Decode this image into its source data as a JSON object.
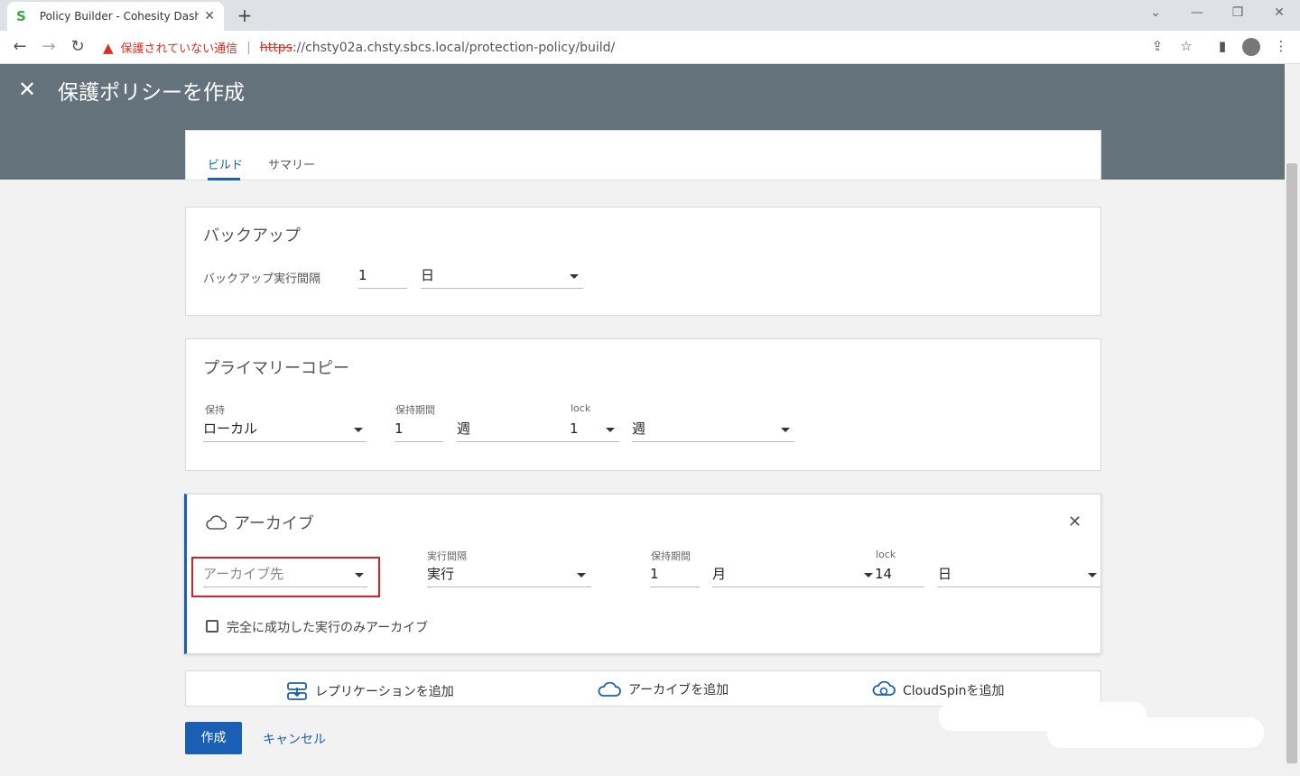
{
  "browser": {
    "tab_title": "Policy Builder - Cohesity Dashbo",
    "tab_close": "✕",
    "new_tab": "+",
    "security_warning": "保護されていない通信",
    "url_scheme": "https",
    "url_rest": "://chsty02a.chsty.sbcs.local/protection-policy/build/"
  },
  "header": {
    "close_label": "✕",
    "title": "保護ポリシーを作成"
  },
  "tabs": [
    {
      "label": "ビルド",
      "active": true
    },
    {
      "label": "サマリー",
      "active": false
    }
  ],
  "backup": {
    "title": "バックアップ",
    "interval_label": "バックアップ実行間隔",
    "interval_value": "1",
    "interval_unit": "日"
  },
  "primary_copy": {
    "title": "プライマリーコピー",
    "retain_label": "保持",
    "retain_value": "ローカル",
    "period_label": "保持期間",
    "period_value": "1",
    "period_unit": "週",
    "lock_label": "lock",
    "lock_value": "1",
    "lock_unit": "週"
  },
  "archive": {
    "title": "アーカイブ",
    "target_placeholder": "アーカイブ先",
    "interval_label": "実行間隔",
    "interval_value": "実行",
    "period_label": "保持期間",
    "period_value": "1",
    "period_unit": "月",
    "lock_label": "lock",
    "lock_value": "14",
    "lock_unit": "日",
    "checkbox_label": "完全に成功した実行のみアーカイブ",
    "close_label": "✕"
  },
  "add_bar": {
    "replication": "レプリケーションを追加",
    "archive": "アーカイブを追加",
    "cloudspin": "CloudSpinを追加"
  },
  "actions": {
    "create": "作成",
    "cancel": "キャンセル"
  },
  "colors": {
    "accent": "#1a5fb4",
    "header_bg": "#64727c",
    "warning": "#d93025",
    "highlight_box": "#d8202b"
  }
}
